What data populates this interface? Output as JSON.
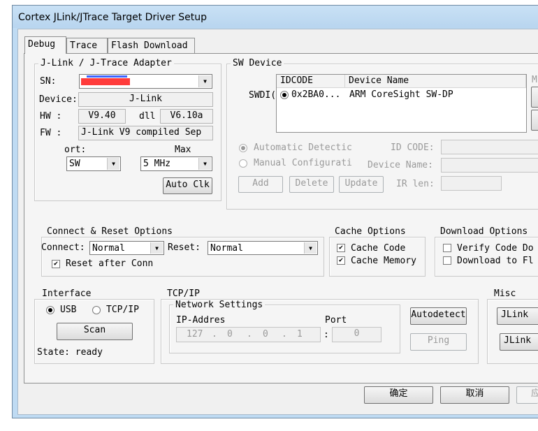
{
  "window": {
    "title": "Cortex JLink/JTrace Target Driver Setup"
  },
  "tabs": [
    {
      "label": "Debug",
      "active": true
    },
    {
      "label": "Trace",
      "active": false
    },
    {
      "label": "Flash Download",
      "active": false
    }
  ],
  "adapter": {
    "group_label": "J-Link / J-Trace Adapter",
    "sn_label": "SN:",
    "device_label": "Device:",
    "device_value": "J-Link",
    "hw_label": "HW :",
    "hw_value": "V9.40",
    "dll_label": "dll",
    "dll_value": "V6.10a",
    "fw_label": "FW :",
    "fw_value": "J-Link V9 compiled Sep",
    "port_label": "ort:",
    "port_value": "SW",
    "max_label": "Max",
    "max_value": "5 MHz",
    "auto_clk_label": "Auto Clk"
  },
  "sw_device": {
    "group_label": "SW Device",
    "side_label": "SWDI(",
    "columns": [
      "IDCODE",
      "Device Name"
    ],
    "rows": [
      {
        "idcode": "0x2BA0...",
        "name": "ARM CoreSight SW-DP"
      }
    ],
    "right_label": "M",
    "auto_detect_label": "Automatic Detectic",
    "manual_config_label": "Manual Configurati",
    "id_code_label": "ID CODE:",
    "device_name_label": "Device Name:",
    "ir_len_label": "IR len:",
    "add_label": "Add",
    "delete_label": "Delete",
    "update_label": "Update"
  },
  "connect_reset": {
    "group_label": "Connect & Reset Options",
    "connect_label": "Connect:",
    "connect_value": "Normal",
    "reset_label": "Reset:",
    "reset_value": "Normal",
    "reset_after_label": "Reset after Conn",
    "reset_after_checked": true
  },
  "cache": {
    "group_label": "Cache Options",
    "cache_code_label": "Cache Code",
    "cache_code_checked": true,
    "cache_memory_label": "Cache Memory",
    "cache_memory_checked": true
  },
  "download": {
    "group_label": "Download Options",
    "verify_label": "Verify Code Do",
    "verify_checked": false,
    "download_label": "Download to Fl",
    "download_checked": false
  },
  "interface": {
    "group_label": "Interface",
    "usb_label": "USB",
    "usb_selected": true,
    "tcpip_label": "TCP/IP",
    "scan_label": "Scan",
    "state_text": "State: ready"
  },
  "tcpip": {
    "group_label": "TCP/IP",
    "network_label": "Network Settings",
    "ip_label": "IP-Addres",
    "port_label": "Port",
    "ip_octets": [
      "127",
      "0",
      "0",
      "1"
    ],
    "port_value": "0",
    "autodetect_label": "Autodetect",
    "ping_label": "Ping"
  },
  "misc": {
    "group_label": "Misc",
    "jlink_label_1": "JLink",
    "jlink_label_2": "JLink"
  },
  "footer": {
    "ok_label": "确定",
    "cancel_label": "取消",
    "apply_label": "应"
  },
  "colors": {
    "redaction": "#ff3b3b",
    "title_bar": "#c9e1f5",
    "redaction_accent": "#3b63ff"
  }
}
